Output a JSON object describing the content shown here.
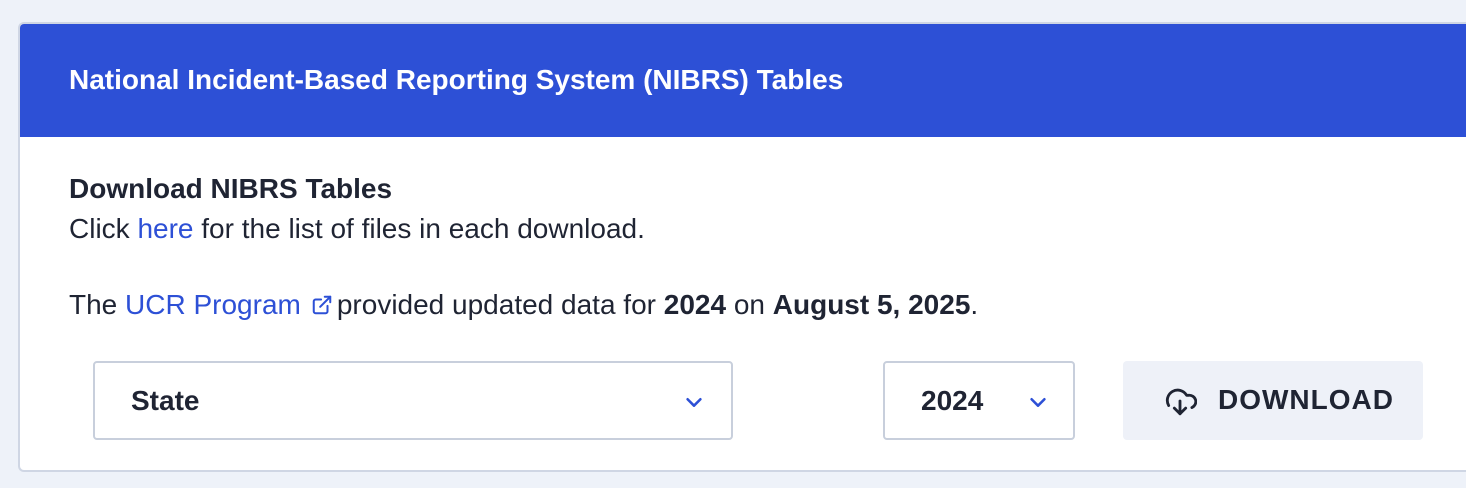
{
  "card": {
    "title": "National Incident-Based Reporting System (NIBRS) Tables"
  },
  "section": {
    "title": "Download NIBRS Tables",
    "line1": {
      "prefix": "Click ",
      "link_text": "here",
      "suffix": " for the list of files in each download."
    },
    "line2": {
      "prefix": "The ",
      "link_text": "UCR Program",
      "middle": "provided updated data for ",
      "year": "2024",
      "on_text": " on ",
      "date": "August 5, 2025",
      "end": "."
    }
  },
  "controls": {
    "state_select": {
      "value": "State"
    },
    "year_select": {
      "value": "2024"
    },
    "download_button": {
      "label": "DOWNLOAD"
    }
  },
  "icons": {
    "external_link": "external-link-icon",
    "chevron": "chevron-down-icon",
    "download": "cloud-download-icon"
  },
  "colors": {
    "header_bg": "#2d50d6",
    "link": "#2d50d6",
    "text": "#1f2433",
    "page_bg": "#eef2f9",
    "button_bg": "#eef1f8"
  }
}
